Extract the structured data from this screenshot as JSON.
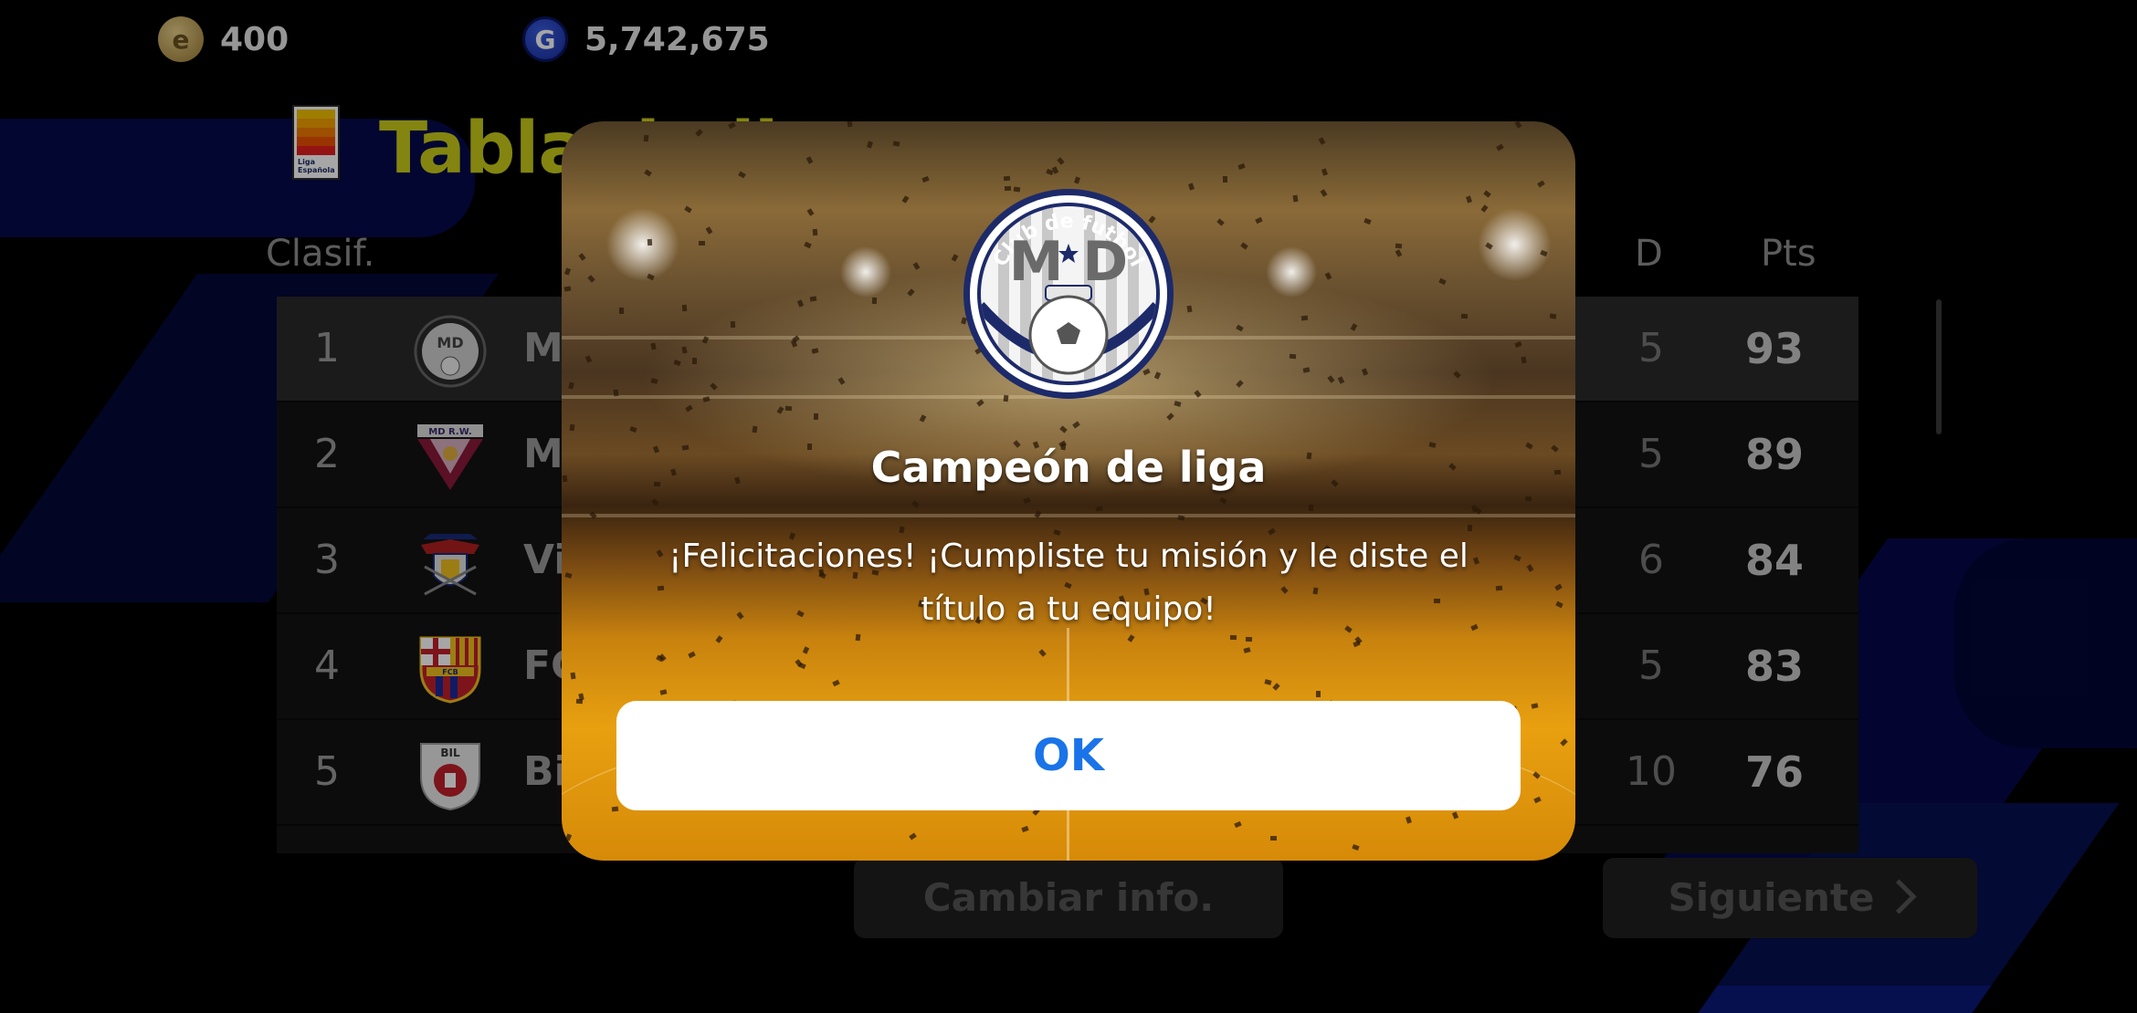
{
  "currency": {
    "coins": "400",
    "gp": "5,742,675",
    "coin_icon_letter": "e",
    "gp_icon_letter": "G"
  },
  "header": {
    "title": "Tabla de liga",
    "league_logo_text": "Liga Española"
  },
  "table": {
    "col_rank": "Clasif.",
    "col_d": "D",
    "col_pts": "Pts",
    "rows": [
      {
        "rank": "1",
        "team": "Ma",
        "d": "5",
        "pts": "93"
      },
      {
        "rank": "2",
        "team": "Ma",
        "d": "5",
        "pts": "89"
      },
      {
        "rank": "3",
        "team": "Vi",
        "d": "6",
        "pts": "84"
      },
      {
        "rank": "4",
        "team": "FC",
        "d": "5",
        "pts": "83"
      },
      {
        "rank": "5",
        "team": "Bi",
        "d": "10",
        "pts": "76"
      }
    ],
    "crest_texts": [
      "MD",
      "MD R.W.",
      "",
      "FCB",
      "BIL"
    ]
  },
  "buttons": {
    "change_info": "Cambiar info.",
    "next": "Siguiente"
  },
  "modal": {
    "badge_top": "Club de futbol",
    "badge_letters": "M D",
    "title": "Campeón de liga",
    "message": "¡Felicitaciones! ¡Cumpliste tu misión y le diste el título a tu equipo!",
    "ok": "OK",
    "ok_color": "#1a73e8"
  }
}
